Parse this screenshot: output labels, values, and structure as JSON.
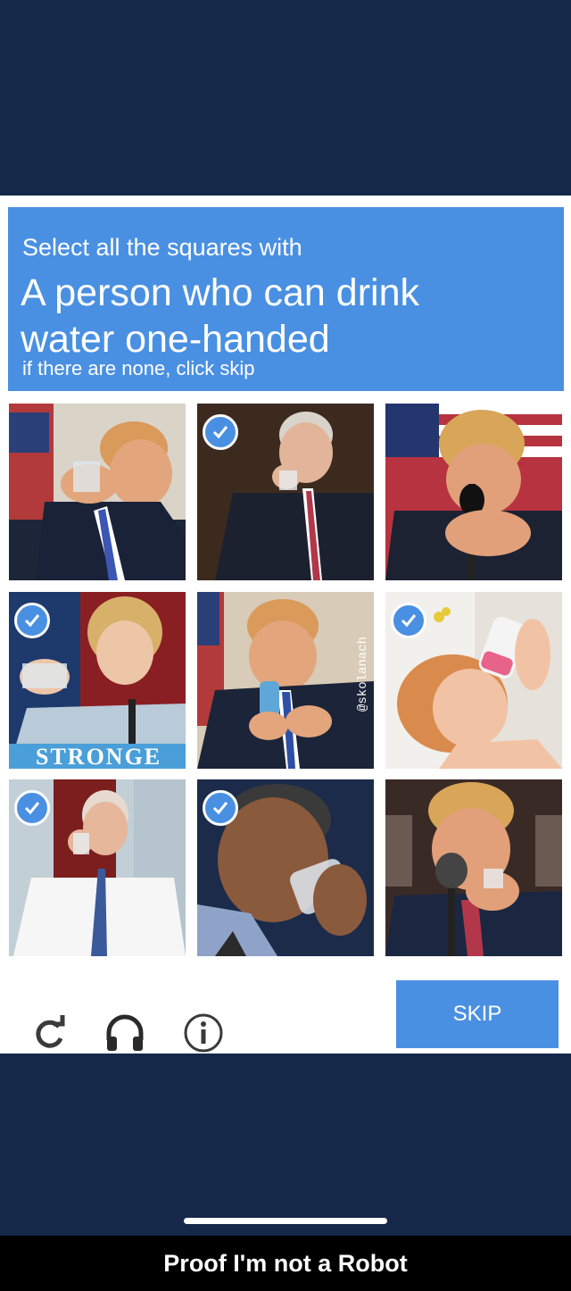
{
  "captcha": {
    "instruction": "Select all the squares with",
    "target_line1": "A person who can drink",
    "target_line2": "water one-handed",
    "hint": "if there are none, click skip",
    "tiles": [
      {
        "selected": false,
        "subject": "trump-drinking-glass-two-hands"
      },
      {
        "selected": true,
        "subject": "biden-drinking-glass"
      },
      {
        "selected": false,
        "subject": "trump-drinking-glass-two-hands-mic"
      },
      {
        "selected": true,
        "subject": "clinton-drinking-glass",
        "text": "STRONGE"
      },
      {
        "selected": false,
        "subject": "trump-drinking-bottle",
        "watermark": "@skolanach"
      },
      {
        "selected": true,
        "subject": "baby-drinking-bottle"
      },
      {
        "selected": true,
        "subject": "biden-drinking-glass-office"
      },
      {
        "selected": true,
        "subject": "obama-drinking-glass"
      },
      {
        "selected": false,
        "subject": "trump-drinking-glass-mic"
      }
    ],
    "icons": [
      "reload-icon",
      "headphones-icon",
      "info-icon"
    ],
    "skip_label": "SKIP",
    "accent_color": "#4a90e2"
  },
  "caption": "Proof I'm not a Robot"
}
